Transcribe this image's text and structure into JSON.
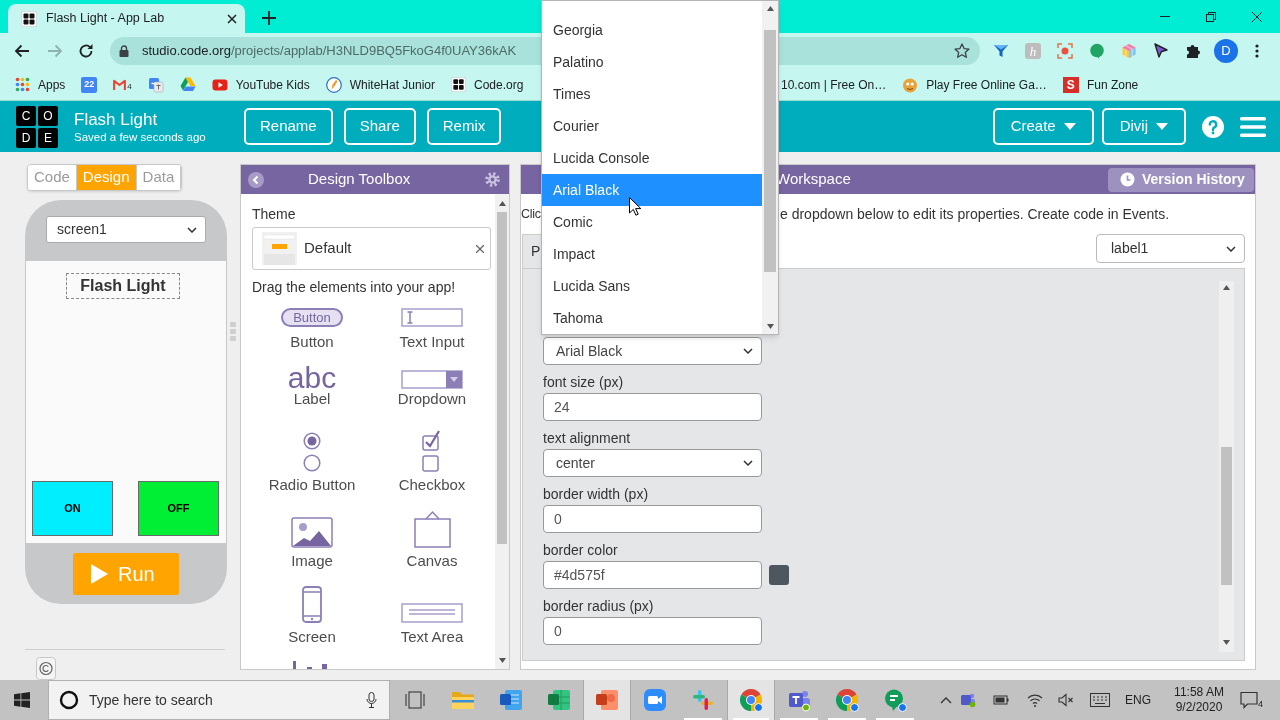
{
  "browser": {
    "tabs": [
      {
        "title": "Flash Light - App Lab",
        "selected": true
      }
    ],
    "forward_disabled": true,
    "url_host": "studio.code.org",
    "url_path": "/projects/applab/H3NLD9BQ5FkoG4f0UAY36kAK",
    "extension_tile_text": "h",
    "profile_initial": "D",
    "bookmarks_left": [
      {
        "kind": "apps",
        "label": "Apps"
      },
      {
        "kind": "calendar",
        "icon_text": "22"
      },
      {
        "kind": "mail",
        "badge": "4"
      },
      {
        "kind": "translate"
      },
      {
        "kind": "drive"
      },
      {
        "kind": "video",
        "label": "YouTube Kids"
      },
      {
        "kind": "pencil",
        "label": "WhiteHat Junior"
      },
      {
        "kind": "grid",
        "label": "Code.org"
      }
    ],
    "bookmarks_right": [
      {
        "label": "10.com | Free On…"
      },
      {
        "kind": "mascot",
        "label": "Play Free Online Ga…"
      },
      {
        "kind": "letter",
        "icon_text": "S",
        "label": "Fun Zone"
      }
    ]
  },
  "app": {
    "logo_letters": [
      "C",
      "O",
      "D",
      "E"
    ],
    "project_title": "Flash Light",
    "save_status": "Saved a few seconds ago",
    "project_buttons": [
      "Rename",
      "Share",
      "Remix"
    ],
    "menus": [
      "Create",
      "Divij"
    ]
  },
  "mode_tabs": [
    {
      "label": "Code",
      "selected": false
    },
    {
      "label": "Design",
      "selected": true
    },
    {
      "label": "Data",
      "selected": false
    }
  ],
  "phone": {
    "screen_select": "screen1",
    "app_label": "Flash Light",
    "app_buttons": [
      {
        "label": "ON",
        "color": "#00eeff"
      },
      {
        "label": "OFF",
        "color": "#00ee33"
      }
    ],
    "run_button": "Run"
  },
  "toolbox": {
    "title": "Design Toolbox",
    "theme_label": "Theme",
    "theme_value": "Default",
    "hint": "Drag the elements into your app!",
    "elements": [
      {
        "kind": "button",
        "icon_text": "Button",
        "label": "Button"
      },
      {
        "kind": "text_input",
        "label": "Text Input"
      },
      {
        "kind": "label",
        "icon_text": "abc",
        "label": "Label"
      },
      {
        "kind": "dropdown",
        "label": "Dropdown"
      },
      {
        "kind": "radio",
        "label": "Radio Button"
      },
      {
        "kind": "checkbox",
        "label": "Checkbox"
      },
      {
        "kind": "image",
        "label": "Image"
      },
      {
        "kind": "canvas",
        "label": "Canvas"
      },
      {
        "kind": "screen",
        "label": "Screen"
      },
      {
        "kind": "text_area",
        "label": "Text Area"
      },
      {
        "kind": "chart"
      }
    ]
  },
  "workspace": {
    "title": "Workspace",
    "version_history": "Version History",
    "instruction_parts": [
      "Clic",
      "e dropdown below to edit its properties. Create code in Events."
    ],
    "properties_tab": {
      "label": "P",
      "selected": true
    },
    "element_select": "label1",
    "fields": [
      {
        "kind": "select",
        "value": "Arial Black"
      },
      {
        "kind": "input",
        "label": "font size (px)",
        "value": "24"
      },
      {
        "kind": "select",
        "label": "text alignment",
        "value": "center"
      },
      {
        "kind": "input",
        "label": "border width (px)",
        "value": "0"
      },
      {
        "kind": "color",
        "label": "border color",
        "value": "#4d575f",
        "color": "#4d575f"
      },
      {
        "kind": "input",
        "label": "border radius (px)",
        "value": "0"
      }
    ]
  },
  "font_menu": {
    "options": [
      {
        "label": "Georgia",
        "selected": false
      },
      {
        "label": "Palatino",
        "selected": false
      },
      {
        "label": "Times",
        "selected": false
      },
      {
        "label": "Courier",
        "selected": false
      },
      {
        "label": "Lucida Console",
        "selected": false
      },
      {
        "label": "Arial Black",
        "selected": true
      },
      {
        "label": "Comic",
        "selected": false
      },
      {
        "label": "Impact",
        "selected": false
      },
      {
        "label": "Lucida Sans",
        "selected": false
      },
      {
        "label": "Tahoma",
        "selected": false
      }
    ]
  },
  "taskbar": {
    "search_placeholder": "Type here to search",
    "apps": [
      {
        "kind": "task_view",
        "selected": false,
        "running": false
      },
      {
        "kind": "folder",
        "selected": false,
        "running": false
      },
      {
        "kind": "document",
        "selected": false,
        "running": false
      },
      {
        "kind": "spreadsheet",
        "selected": false,
        "running": false
      },
      {
        "kind": "slides",
        "selected": true,
        "running": false
      },
      {
        "kind": "video",
        "selected": false,
        "running": false
      },
      {
        "kind": "hash",
        "selected": false,
        "running": true
      },
      {
        "kind": "browser",
        "selected": true,
        "running": true
      },
      {
        "kind": "team_chat",
        "selected": false,
        "running": true
      },
      {
        "kind": "browser",
        "selected": false,
        "running": true
      },
      {
        "kind": "chat",
        "selected": false,
        "running": true
      }
    ],
    "language": "ENG",
    "time": "11:58 AM",
    "date": "9/2/2020",
    "notification_count": "4"
  }
}
